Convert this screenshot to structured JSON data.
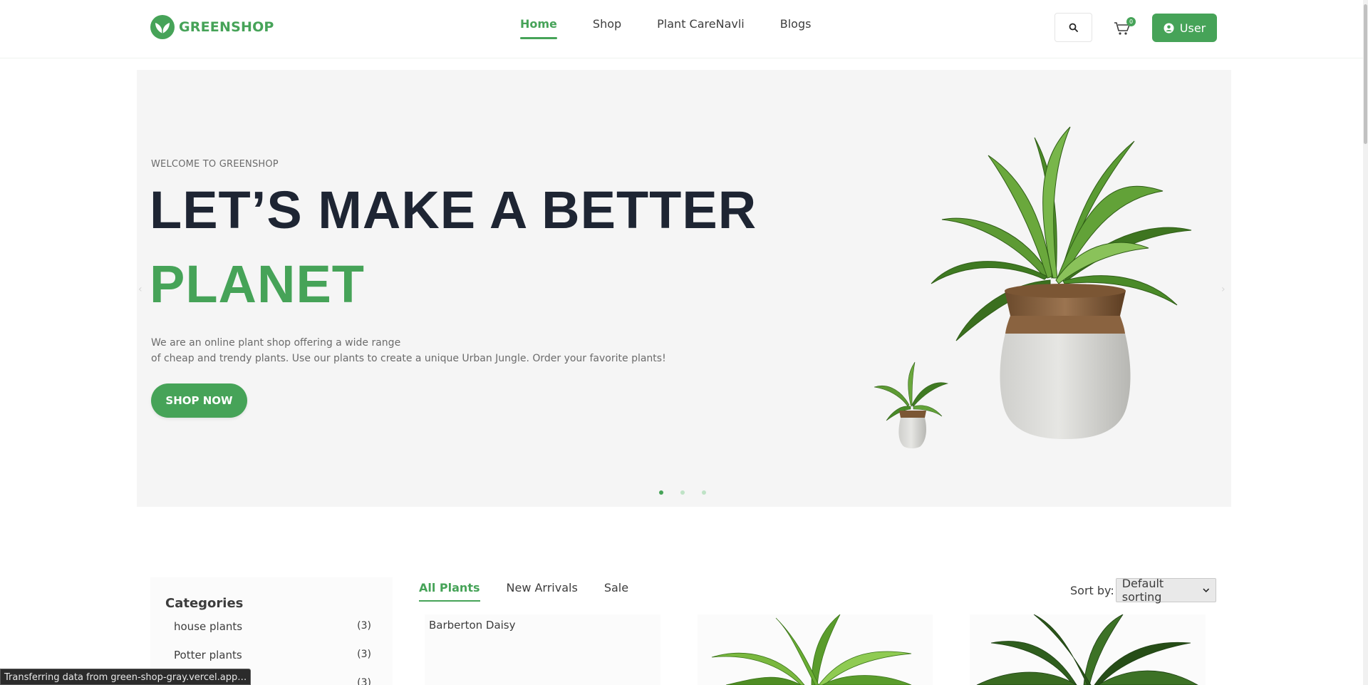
{
  "header": {
    "logo_text": "GREENSHOP",
    "nav": [
      {
        "label": "Home",
        "active": true
      },
      {
        "label": "Shop",
        "active": false
      },
      {
        "label": "Plant CareNavli",
        "active": false
      },
      {
        "label": "Blogs",
        "active": false
      }
    ],
    "cart_count": "0",
    "user_label": "User"
  },
  "hero": {
    "welcome": "WELCOME TO GREENSHOP",
    "title": "LET’S MAKE A BETTER",
    "title_accent": "PLANET",
    "description_line1": "We are an online plant shop offering a wide range",
    "description_line2": "of cheap and trendy plants. Use our plants to create a unique Urban Jungle. Order your favorite plants!",
    "cta_label": "SHOP NOW",
    "slide_count": 3,
    "active_slide": 1
  },
  "categories": {
    "title": "Categories",
    "items": [
      {
        "label": "house plants",
        "count": "(3)"
      },
      {
        "label": "Potter plants",
        "count": "(3)"
      },
      {
        "label": "",
        "count": "(3)"
      }
    ]
  },
  "product_tabs": {
    "tabs": [
      {
        "label": "All Plants",
        "active": true
      },
      {
        "label": "New Arrivals",
        "active": false
      },
      {
        "label": "Sale",
        "active": false
      }
    ],
    "sort_label": "Sort by:",
    "sort_value": "Default sorting"
  },
  "products": [
    {
      "name": "Barberton Daisy"
    },
    {
      "name": ""
    },
    {
      "name": ""
    }
  ],
  "status_bar": {
    "text": "Transferring data from green-shop-gray.vercel.app…"
  },
  "colors": {
    "brand_green": "#46a358",
    "heading_dark": "#1e2533",
    "hero_bg": "#f5f5f5"
  }
}
